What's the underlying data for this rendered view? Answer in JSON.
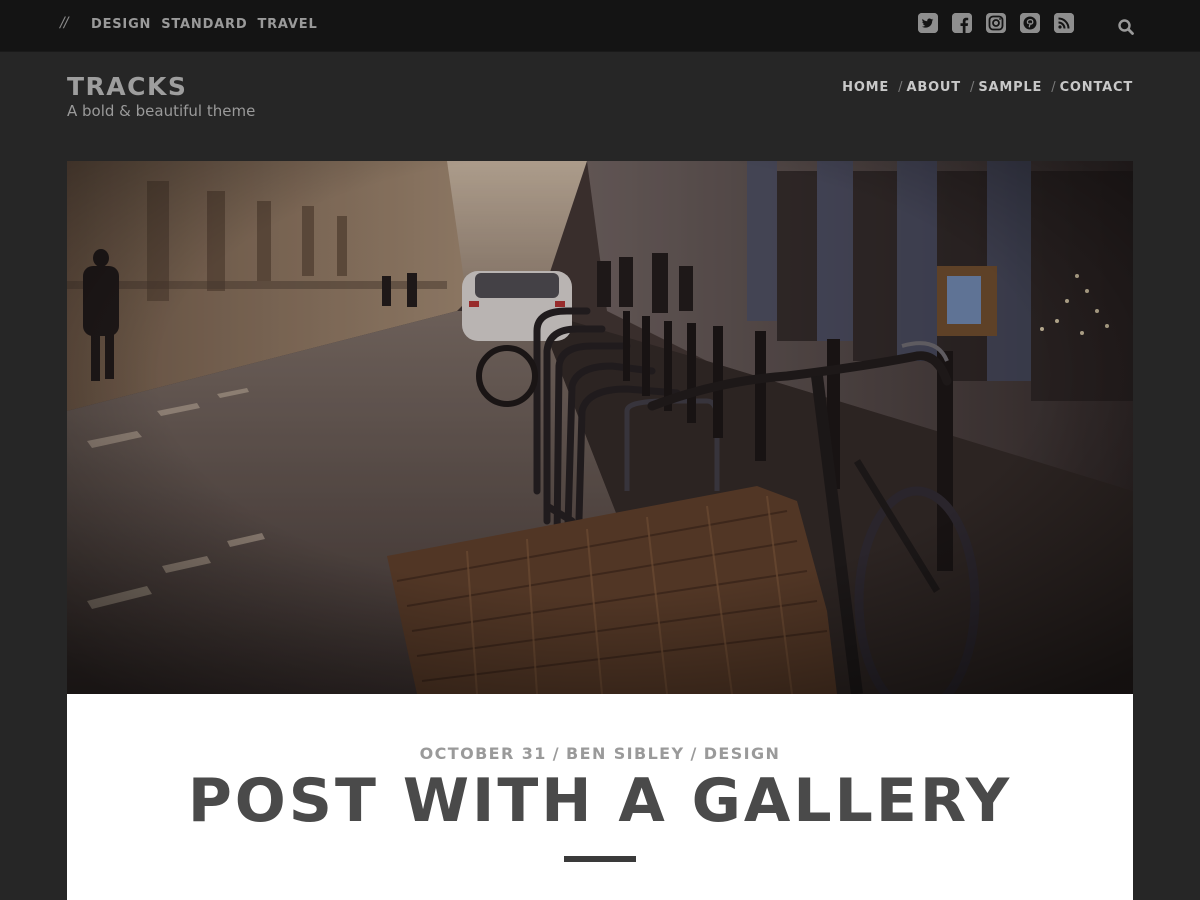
{
  "topbar": {
    "decor": "//",
    "categories": [
      "DESIGN",
      "STANDARD",
      "TRAVEL"
    ],
    "social": [
      "twitter-icon",
      "facebook-icon",
      "instagram-icon",
      "pinterest-icon",
      "rss-icon"
    ],
    "search_icon": "search-icon"
  },
  "header": {
    "title": "TRACKS",
    "tagline": "A bold & beautiful theme",
    "nav": [
      "HOME",
      "ABOUT",
      "SAMPLE",
      "CONTACT"
    ],
    "nav_separator": "/"
  },
  "post": {
    "date": "OCTOBER 31",
    "author": "BEN SIBLEY",
    "category": "DESIGN",
    "meta_separator": "/",
    "title": "POST WITH A GALLERY"
  },
  "colors": {
    "topbar_bg": "#141414",
    "page_bg": "#262626",
    "card_bg": "#ffffff",
    "title_text": "#4a4a4a"
  }
}
